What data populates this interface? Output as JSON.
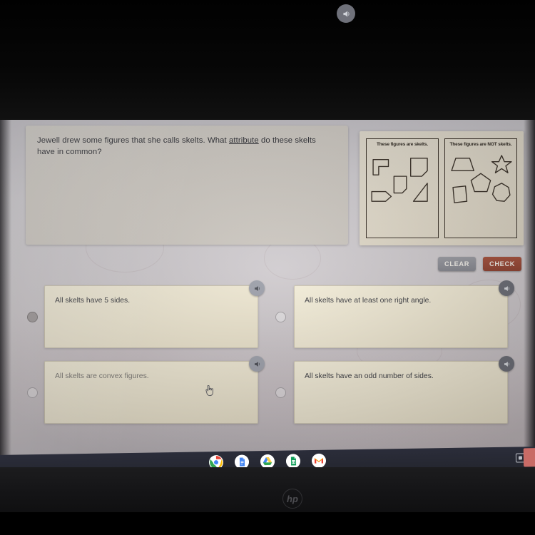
{
  "question": {
    "text_before_underline": "Jewell drew some figures that she calls skelts. What ",
    "underlined_word": "attribute",
    "text_after_underline": " do these skelts have in common?",
    "speaker_icon": "speaker-icon"
  },
  "figure": {
    "panels": [
      {
        "title": "These figures are skelts.",
        "shapes": [
          "L-shape",
          "clipped-corner-square",
          "small-clipped-square",
          "house-pentagon",
          "right-triangle"
        ]
      },
      {
        "title": "These figures are NOT skelts.",
        "shapes": [
          "trapezoid",
          "six-pointed-star",
          "pentagon",
          "parallelogram",
          "heptagon"
        ]
      }
    ]
  },
  "actions": {
    "clear_label": "CLEAR",
    "check_label": "CHECK",
    "clear_color": "#8e8f97",
    "check_color": "#9a4636"
  },
  "options": [
    {
      "label": "All skelts have 5 sides.",
      "selected": true,
      "speaker_icon": "speaker-icon"
    },
    {
      "label": "All skelts have at least one right angle.",
      "selected": false,
      "speaker_icon": "speaker-icon"
    },
    {
      "label": "All skelts are convex figures.",
      "selected": false,
      "speaker_icon": "speaker-icon"
    },
    {
      "label": "All skelts have an odd number of sides.",
      "selected": false,
      "speaker_icon": "speaker-icon"
    }
  ],
  "taskbar": {
    "apps": [
      {
        "name": "chrome-icon",
        "letter": ""
      },
      {
        "name": "google-docs-icon",
        "letter": ""
      },
      {
        "name": "google-drive-icon",
        "letter": ""
      },
      {
        "name": "google-sheets-icon",
        "letter": ""
      },
      {
        "name": "gmail-icon",
        "letter": "M"
      }
    ],
    "tray_window_icon": "window-icon"
  },
  "device": {
    "brand_logo": "hp"
  },
  "cursor": {
    "type": "pointing-hand-cursor"
  }
}
